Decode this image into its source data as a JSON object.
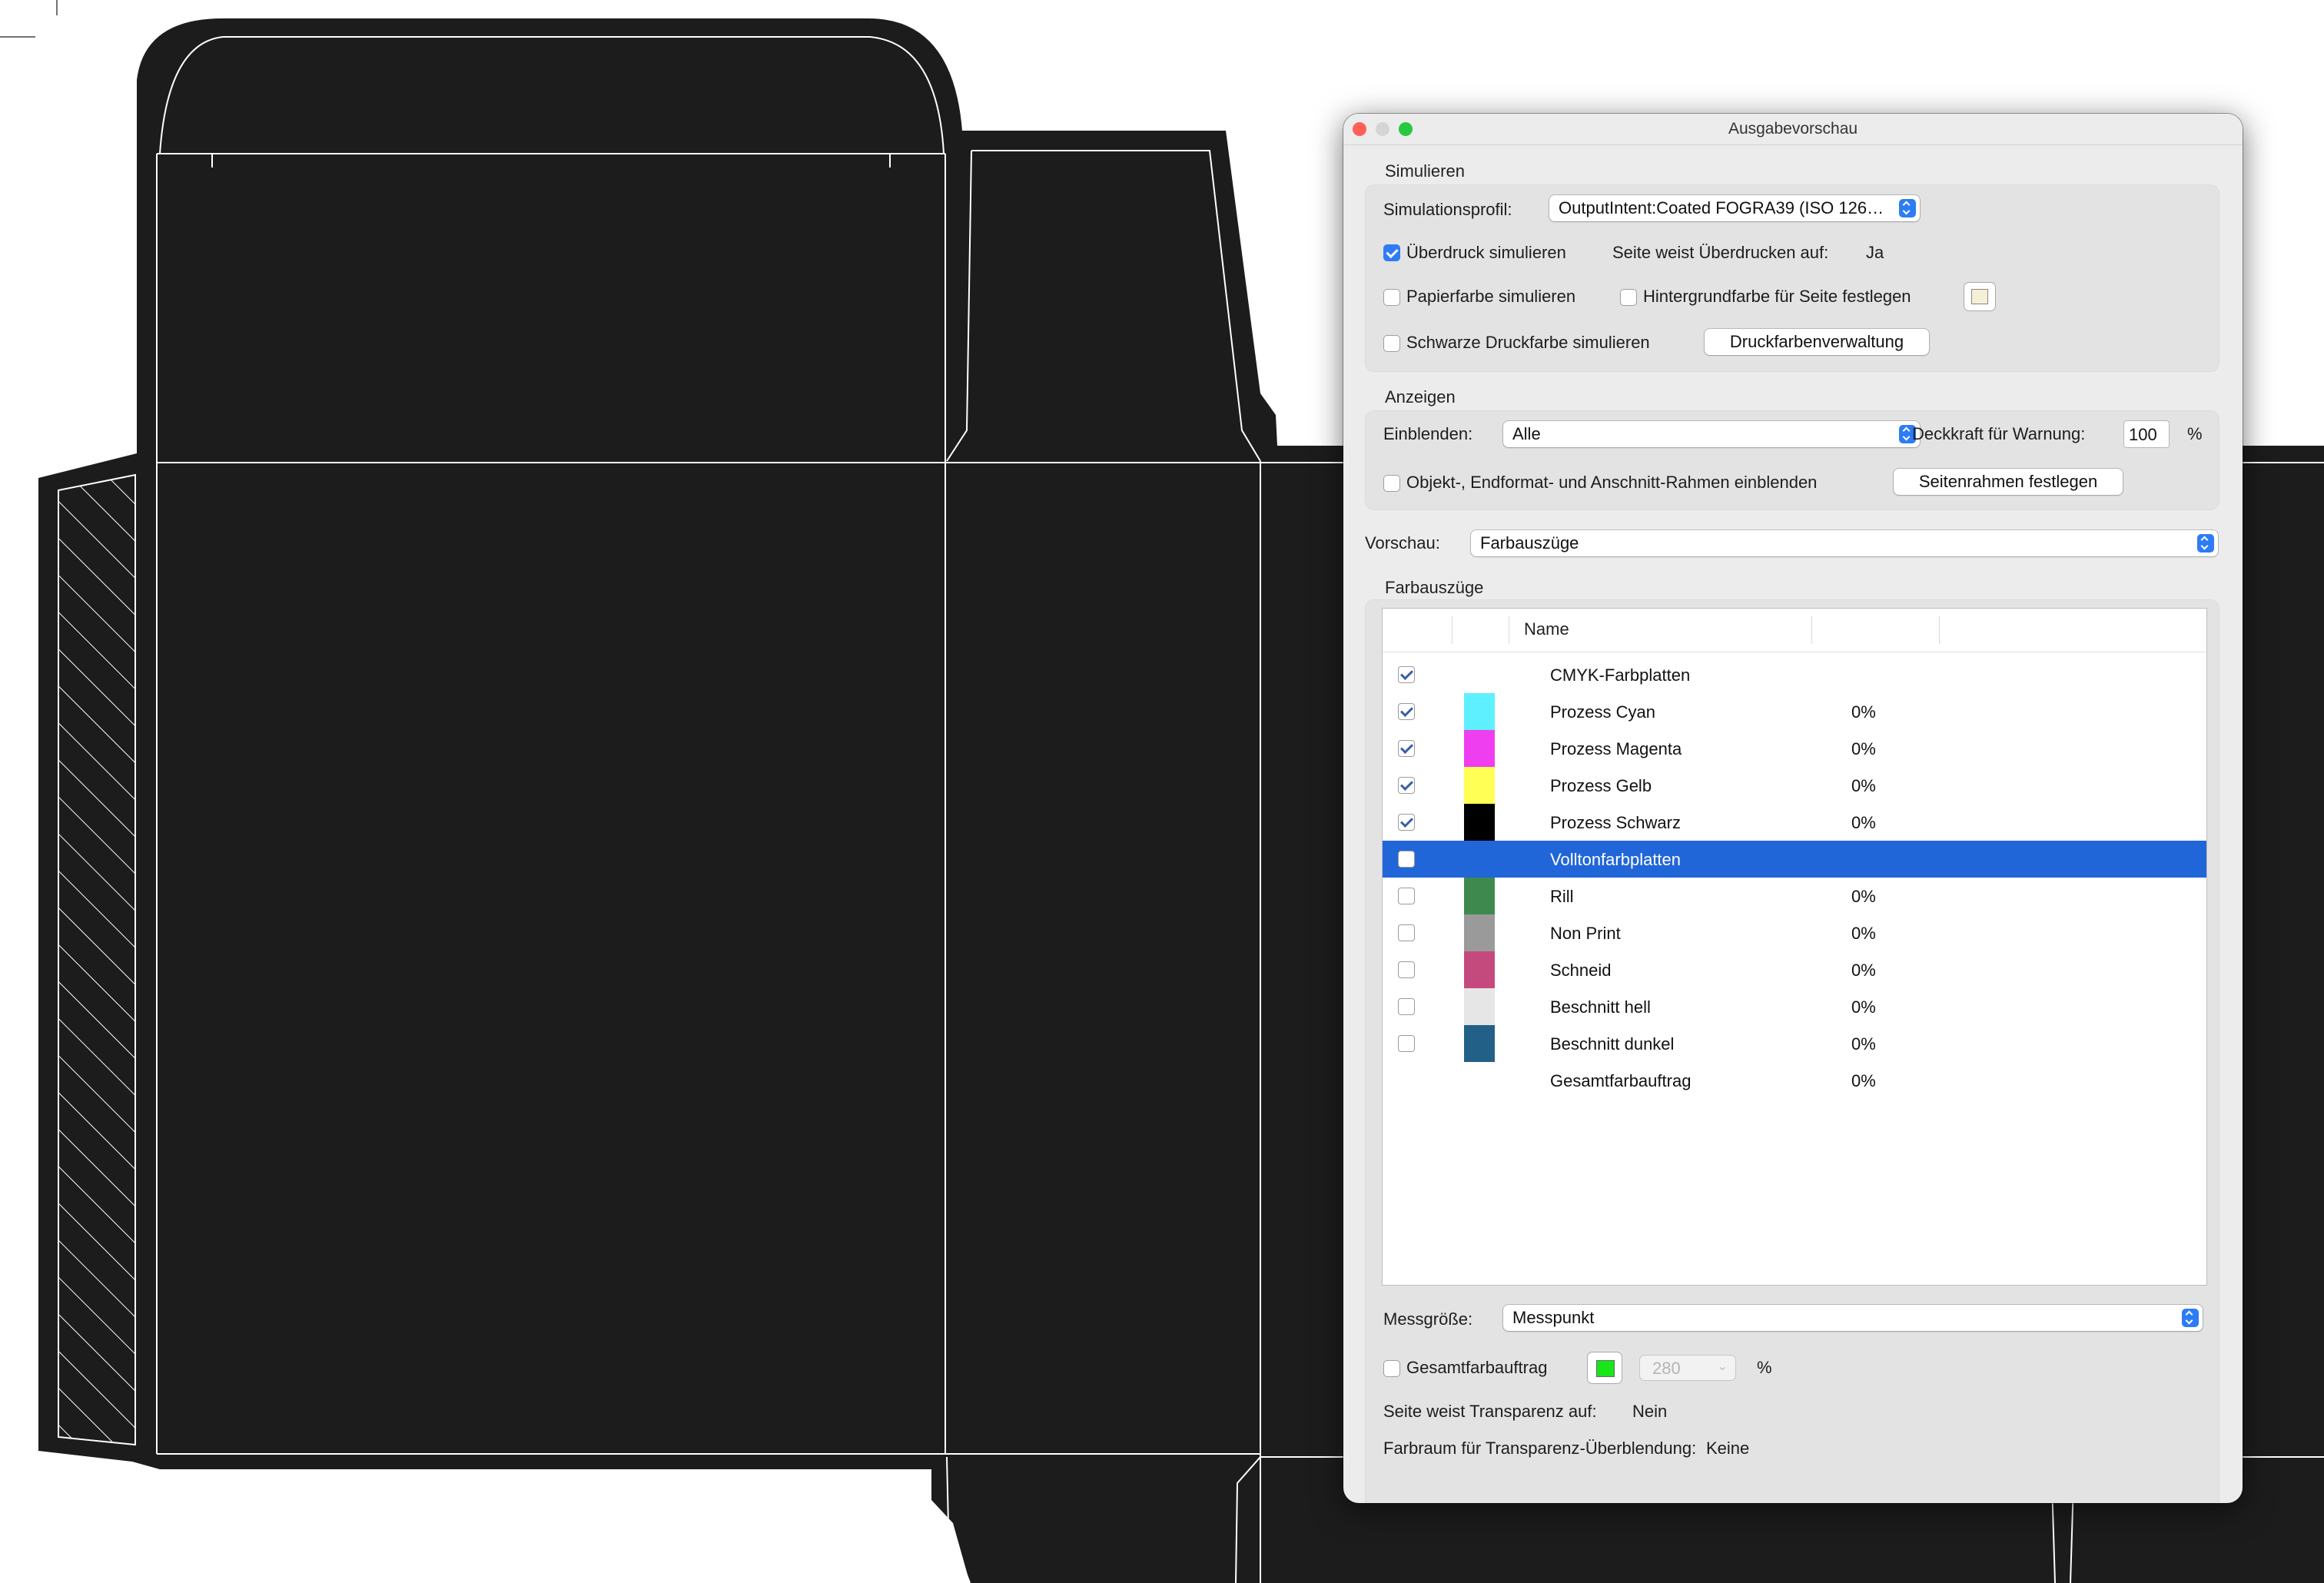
{
  "dialog": {
    "title": "Ausgabevorschau",
    "simulate": {
      "header": "Simulieren",
      "profile_label": "Simulationsprofil:",
      "profile_value": "OutputIntent:Coated FOGRA39 (ISO 126…",
      "overprint_label": "Überdruck simulieren",
      "overprint_checked": true,
      "page_overprint_label": "Seite weist Überdrucken auf:",
      "page_overprint_value": "Ja",
      "paper_color_label": "Papierfarbe simulieren",
      "bg_color_label": "Hintergrundfarbe für Seite festlegen",
      "black_ink_label": "Schwarze Druckfarbe simulieren",
      "ink_manager_button": "Druckfarbenverwaltung",
      "bg_swatch_color": "#f5efd6"
    },
    "display": {
      "header": "Anzeigen",
      "show_label": "Einblenden:",
      "show_value": "Alle",
      "opacity_label": "Deckkraft für Warnung:",
      "opacity_value": "100",
      "opacity_unit": "%",
      "frames_label": "Objekt-, Endformat- und Anschnitt-Rahmen einblenden",
      "frames_button": "Seitenrahmen festlegen"
    },
    "preview": {
      "label": "Vorschau:",
      "value": "Farbauszüge"
    },
    "separations": {
      "header": "Farbauszüge",
      "column_name": "Name",
      "rows": [
        {
          "name": "CMYK-Farbplatten",
          "pct": "",
          "checked": true,
          "color": ""
        },
        {
          "name": "Prozess Cyan",
          "pct": "0%",
          "checked": true,
          "color": "#5ef0ff"
        },
        {
          "name": "Prozess Magenta",
          "pct": "0%",
          "checked": true,
          "color": "#ef3ef0"
        },
        {
          "name": "Prozess Gelb",
          "pct": "0%",
          "checked": true,
          "color": "#ffff55"
        },
        {
          "name": "Prozess Schwarz",
          "pct": "0%",
          "checked": true,
          "color": "#000000"
        },
        {
          "name": "Volltonfarbplatten",
          "pct": "",
          "checked": false,
          "color": "",
          "selected": true
        },
        {
          "name": "Rill",
          "pct": "0%",
          "checked": false,
          "color": "#3e8a4e"
        },
        {
          "name": "Non Print",
          "pct": "0%",
          "checked": false,
          "color": "#9a9a9a"
        },
        {
          "name": "Schneid",
          "pct": "0%",
          "checked": false,
          "color": "#c44a7e"
        },
        {
          "name": "Beschnitt hell",
          "pct": "0%",
          "checked": false,
          "color": "#e6e6e6"
        },
        {
          "name": "Beschnitt dunkel",
          "pct": "0%",
          "checked": false,
          "color": "#236087"
        },
        {
          "name": "Gesamtfarbauftrag",
          "pct": "0%",
          "checked": null,
          "color": ""
        }
      ]
    },
    "measure": {
      "label": "Messgröße:",
      "value": "Messpunkt"
    },
    "total_coverage": {
      "label": "Gesamtfarbauftrag",
      "swatch_color": "#19e619",
      "value": "280",
      "unit": "%"
    },
    "transparency": {
      "label": "Seite weist Transparenz auf:",
      "value": "Nein",
      "blend_label": "Farbraum für Transparenz-Überblendung:",
      "blend_value": "Keine"
    }
  }
}
